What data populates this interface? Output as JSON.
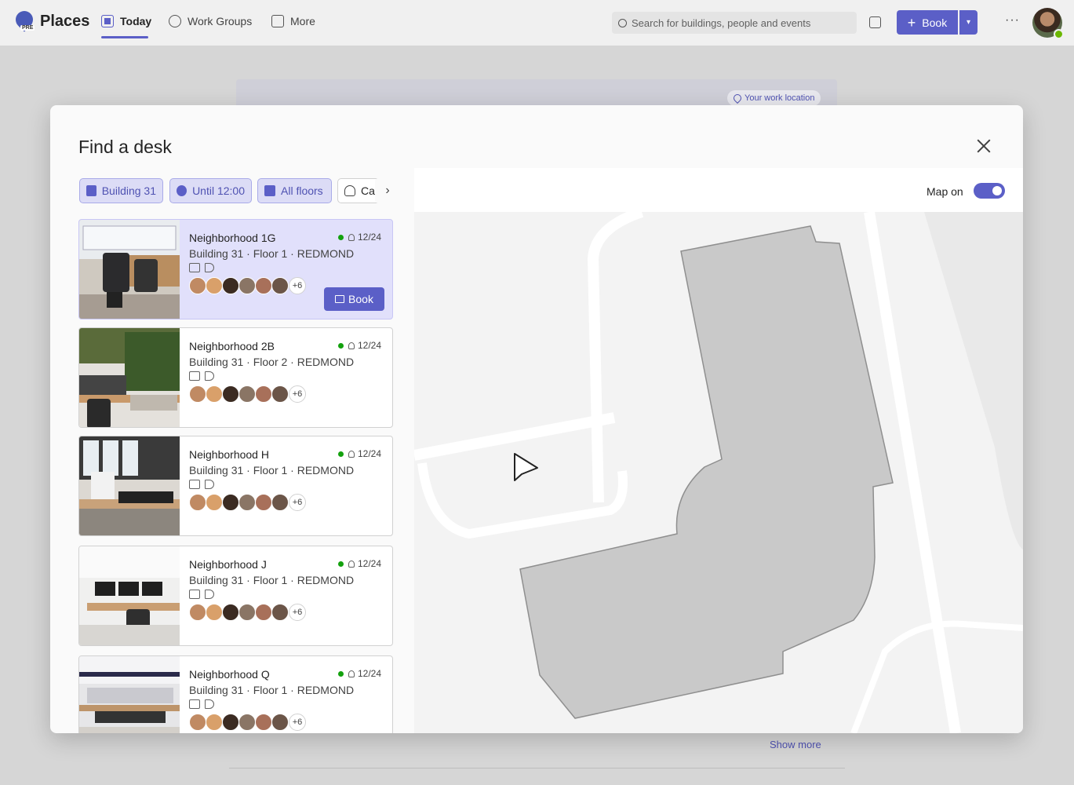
{
  "app": {
    "title": "Places",
    "badge": "PRE",
    "nav": [
      {
        "label": "Today",
        "active": true,
        "icon": "calendar-today-icon"
      },
      {
        "label": "Work Groups",
        "icon": "people-team-icon"
      },
      {
        "label": "More",
        "icon": "apps-grid-icon"
      }
    ],
    "search_placeholder": "Search for buildings, people and events",
    "book_label": "Book",
    "accent": "#5b5fc7"
  },
  "background": {
    "work_location": "Your work location",
    "show_more": "Show more"
  },
  "dialog": {
    "title": "Find a desk",
    "filters": [
      {
        "label": "Building 31",
        "active": true,
        "icon": "building-icon"
      },
      {
        "label": "Until 12:00",
        "active": true,
        "icon": "clock-icon"
      },
      {
        "label": "All floors",
        "active": true,
        "icon": "floors-icon"
      },
      {
        "label": "Ca",
        "active": false,
        "icon": "person-icon"
      }
    ],
    "map_toggle_label": "Map on",
    "map_on": true,
    "book_button": "Book",
    "neighborhoods": [
      {
        "name": "Neighborhood 1G",
        "location": "Building 31 · Floor 1 · REDMOND",
        "count": "12/24",
        "more": "+6",
        "selected": true
      },
      {
        "name": "Neighborhood 2B",
        "location": "Building 31 · Floor 2 · REDMOND",
        "count": "12/24",
        "more": "+6",
        "selected": false
      },
      {
        "name": "Neighborhood H",
        "location": "Building 31 · Floor 1 · REDMOND",
        "count": "12/24",
        "more": "+6",
        "selected": false
      },
      {
        "name": "Neighborhood J",
        "location": "Building 31 · Floor 1 · REDMOND",
        "count": "12/24",
        "more": "+6",
        "selected": false
      },
      {
        "name": "Neighborhood Q",
        "location": "Building 31 · Floor 1 · REDMOND",
        "count": "12/24",
        "more": "+6",
        "selected": false
      }
    ]
  }
}
